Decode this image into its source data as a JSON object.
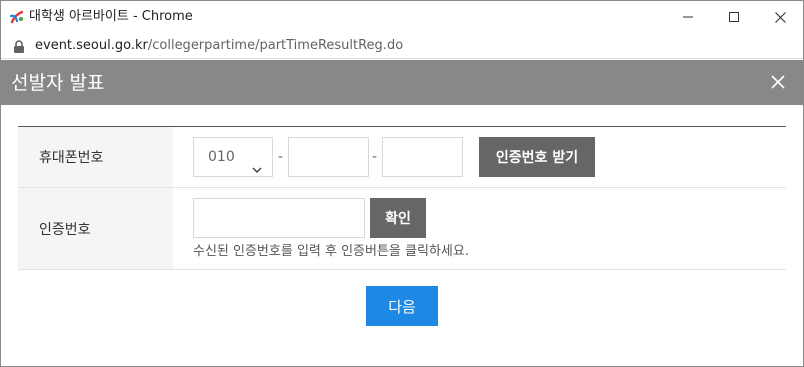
{
  "window": {
    "title": "대학생 아르바이트 - Chrome"
  },
  "address_bar": {
    "url_host": "event.seoul.go.kr",
    "url_path": "/collegerpartime/partTimeResultReg.do"
  },
  "modal": {
    "title": "선발자 발표",
    "phone_row": {
      "label": "휴대폰번호",
      "prefix_value": "010",
      "prefix_options": [
        "010"
      ],
      "dash": "-",
      "middle_value": "",
      "last_value": "",
      "send_button": "인증번호 받기"
    },
    "code_row": {
      "label": "인증번호",
      "code_value": "",
      "confirm_button": "확인",
      "hint": "수신된 인증번호를 입력 후 인증버튼을 클릭하세요."
    },
    "next_button": "다음"
  },
  "colors": {
    "modal_header": "#888888",
    "dark_button": "#666666",
    "primary_button": "#1e88e5",
    "label_cell_bg": "#f4f5f7"
  },
  "icons": {
    "app": "seoul-logo-icon",
    "lock": "lock-icon",
    "minimize": "minimize-icon",
    "maximize": "maximize-icon",
    "window_close": "close-icon",
    "modal_close": "close-icon",
    "select_arrow": "chevron-down-icon"
  }
}
